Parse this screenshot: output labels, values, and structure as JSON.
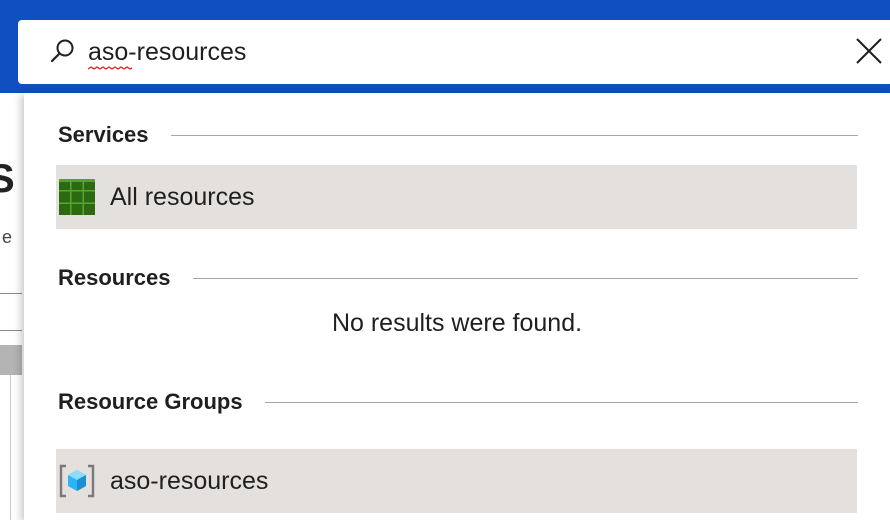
{
  "search": {
    "value": "aso-resources",
    "icon": "search-icon",
    "clear_icon": "close-icon"
  },
  "background_page": {
    "fragment_char_1": "S",
    "fragment_char_2": "e"
  },
  "dropdown": {
    "services": {
      "title": "Services",
      "items": [
        {
          "label": "All resources",
          "icon": "all-resources-grid-icon"
        }
      ]
    },
    "resources": {
      "title": "Resources",
      "empty_message": "No results were found."
    },
    "resource_groups": {
      "title": "Resource Groups",
      "items": [
        {
          "label": "aso-resources",
          "icon": "resource-group-icon"
        }
      ]
    }
  },
  "colors": {
    "header_blue": "#0f4fbf",
    "row_highlight": "#e3e0de",
    "grid_green": "#3a7d1c",
    "cube_blue": "#29b6f6"
  }
}
